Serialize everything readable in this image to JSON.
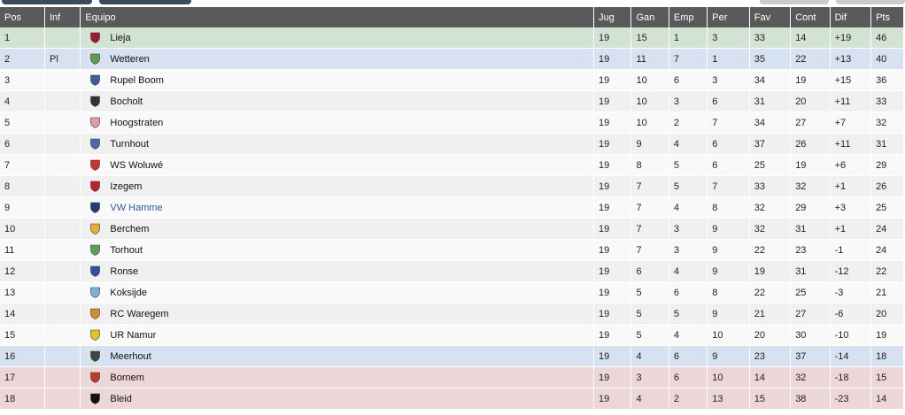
{
  "table": {
    "columns": {
      "pos": "Pos",
      "inf": "Inf",
      "team": "Equipo",
      "played": "Jug",
      "won": "Gan",
      "drawn": "Emp",
      "lost": "Per",
      "gf": "Fav",
      "ga": "Cont",
      "gd": "Dif",
      "pts": "Pts"
    },
    "rows": [
      {
        "pos": "1",
        "inf": "",
        "team": "Lieja",
        "played": "19",
        "won": "15",
        "drawn": "1",
        "lost": "3",
        "gf": "33",
        "ga": "14",
        "gd": "+19",
        "pts": "46",
        "zone": "champ",
        "icon": "crest-shield-red-icon",
        "crest": "#a01c2c"
      },
      {
        "pos": "2",
        "inf": "Pl",
        "team": "Wetteren",
        "played": "19",
        "won": "11",
        "drawn": "7",
        "lost": "1",
        "gf": "35",
        "ga": "22",
        "gd": "+13",
        "pts": "40",
        "zone": "promo",
        "icon": "crest-ball-green-icon",
        "crest": "#5aa04a"
      },
      {
        "pos": "3",
        "inf": "",
        "team": "Rupel Boom",
        "played": "19",
        "won": "10",
        "drawn": "6",
        "lost": "3",
        "gf": "34",
        "ga": "19",
        "gd": "+15",
        "pts": "36",
        "zone": "",
        "icon": "crest-round-blue-icon",
        "crest": "#3c5e9c"
      },
      {
        "pos": "4",
        "inf": "",
        "team": "Bocholt",
        "played": "19",
        "won": "10",
        "drawn": "3",
        "lost": "6",
        "gf": "31",
        "ga": "20",
        "gd": "+11",
        "pts": "33",
        "zone": "",
        "icon": "crest-k-black-icon",
        "crest": "#333333"
      },
      {
        "pos": "5",
        "inf": "",
        "team": "Hoogstraten",
        "played": "19",
        "won": "10",
        "drawn": "2",
        "lost": "7",
        "gf": "34",
        "ga": "27",
        "gd": "+7",
        "pts": "32",
        "zone": "",
        "icon": "crest-pink-icon",
        "crest": "#e29aa4"
      },
      {
        "pos": "6",
        "inf": "",
        "team": "Turnhout",
        "played": "19",
        "won": "9",
        "drawn": "4",
        "lost": "6",
        "gf": "37",
        "ga": "26",
        "gd": "+11",
        "pts": "31",
        "zone": "",
        "icon": "crest-figure-blue-icon",
        "crest": "#4a6aa8"
      },
      {
        "pos": "7",
        "inf": "",
        "team": "WS Woluwé",
        "played": "19",
        "won": "8",
        "drawn": "5",
        "lost": "6",
        "gf": "25",
        "ga": "19",
        "gd": "+6",
        "pts": "29",
        "zone": "",
        "icon": "crest-star-red-icon",
        "crest": "#d23030"
      },
      {
        "pos": "8",
        "inf": "",
        "team": "Izegem",
        "played": "19",
        "won": "7",
        "drawn": "5",
        "lost": "7",
        "gf": "33",
        "ga": "32",
        "gd": "+1",
        "pts": "26",
        "zone": "",
        "icon": "crest-slash-red-icon",
        "crest": "#c0202a"
      },
      {
        "pos": "9",
        "inf": "",
        "team": "VW Hamme",
        "played": "19",
        "won": "7",
        "drawn": "4",
        "lost": "8",
        "gf": "32",
        "ga": "29",
        "gd": "+3",
        "pts": "25",
        "zone": "",
        "icon": "crest-square-blue-icon",
        "crest": "#1f3d7a",
        "link": true
      },
      {
        "pos": "10",
        "inf": "",
        "team": "Berchem",
        "played": "19",
        "won": "7",
        "drawn": "3",
        "lost": "9",
        "gf": "32",
        "ga": "31",
        "gd": "+1",
        "pts": "24",
        "zone": "",
        "icon": "crest-yellow-black-icon",
        "crest": "#e3b22a"
      },
      {
        "pos": "11",
        "inf": "",
        "team": "Torhout",
        "played": "19",
        "won": "7",
        "drawn": "3",
        "lost": "9",
        "gf": "22",
        "ga": "23",
        "gd": "-1",
        "pts": "24",
        "zone": "",
        "icon": "crest-round-green-icon",
        "crest": "#5d9e5a"
      },
      {
        "pos": "12",
        "inf": "",
        "team": "Ronse",
        "played": "19",
        "won": "6",
        "drawn": "4",
        "lost": "9",
        "gf": "19",
        "ga": "31",
        "gd": "-12",
        "pts": "22",
        "zone": "",
        "icon": "crest-sk-blue-icon",
        "crest": "#2f4fa0"
      },
      {
        "pos": "13",
        "inf": "",
        "team": "Koksijde",
        "played": "19",
        "won": "5",
        "drawn": "6",
        "lost": "8",
        "gf": "22",
        "ga": "25",
        "gd": "-3",
        "pts": "21",
        "zone": "",
        "icon": "crest-shield-lightblue-icon",
        "crest": "#7fb1d8"
      },
      {
        "pos": "14",
        "inf": "",
        "team": "RC Waregem",
        "played": "19",
        "won": "5",
        "drawn": "5",
        "lost": "9",
        "gf": "21",
        "ga": "27",
        "gd": "-6",
        "pts": "20",
        "zone": "",
        "icon": "crest-shield-orange-icon",
        "crest": "#d98a2a"
      },
      {
        "pos": "15",
        "inf": "",
        "team": "UR Namur",
        "played": "19",
        "won": "5",
        "drawn": "4",
        "lost": "10",
        "gf": "20",
        "ga": "30",
        "gd": "-10",
        "pts": "19",
        "zone": "",
        "icon": "crest-u-yellow-icon",
        "crest": "#e6c21a"
      },
      {
        "pos": "16",
        "inf": "",
        "team": "Meerhout",
        "played": "19",
        "won": "4",
        "drawn": "6",
        "lost": "9",
        "gf": "23",
        "ga": "37",
        "gd": "-14",
        "pts": "18",
        "zone": "promo",
        "icon": "crest-ball-dark-icon",
        "crest": "#444444"
      },
      {
        "pos": "17",
        "inf": "",
        "team": "Bornem",
        "played": "19",
        "won": "3",
        "drawn": "6",
        "lost": "10",
        "gf": "14",
        "ga": "32",
        "gd": "-18",
        "pts": "15",
        "zone": "releg",
        "icon": "crest-lion-red-icon",
        "crest": "#c0392b"
      },
      {
        "pos": "18",
        "inf": "",
        "team": "Bleid",
        "played": "19",
        "won": "4",
        "drawn": "2",
        "lost": "13",
        "gf": "15",
        "ga": "38",
        "gd": "-23",
        "pts": "14",
        "zone": "releg",
        "icon": "crest-shield-black-icon",
        "crest": "#111111"
      }
    ]
  }
}
